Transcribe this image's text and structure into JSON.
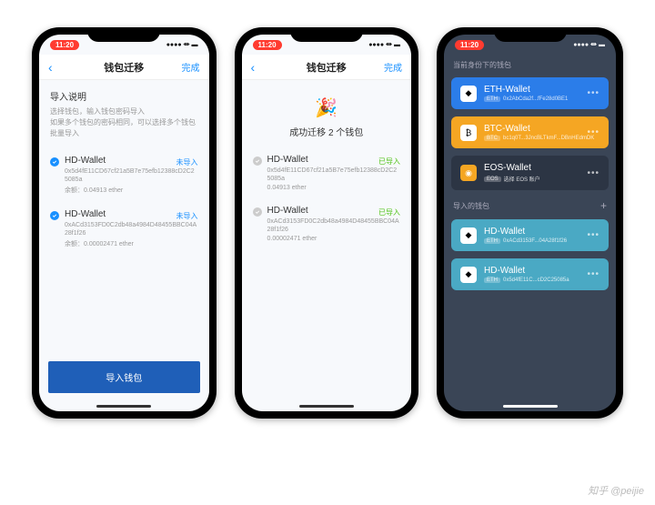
{
  "status_time": "11:20",
  "signal": "●●●● ⏛ ▬",
  "watermark": "知乎 @peijie",
  "s1": {
    "nav_title": "钱包迁移",
    "nav_done": "完成",
    "intro_title": "导入说明",
    "intro_desc1": "选择钱包，输入钱包密码导入",
    "intro_desc2": "如果多个钱包的密码相同，可以选择多个钱包批量导入",
    "w1_name": "HD-Wallet",
    "w1_addr": "0x5d4fE11CD67cf21a5B7e75efb12388cD2C25085a",
    "w1_bal": "余额：0.04913 ether",
    "w1_status": "未导入",
    "w2_name": "HD-Wallet",
    "w2_addr": "0xACd3153FD0C2db48a4984D48455BBC04A28f1f26",
    "w2_bal": "余额：0.00002471 ether",
    "w2_status": "未导入",
    "import_btn": "导入钱包"
  },
  "s2": {
    "nav_title": "钱包迁移",
    "nav_done": "完成",
    "success_text": "成功迁移 2 个钱包",
    "w1_name": "HD-Wallet",
    "w1_addr": "0x5d4fE11CD67cf21a5B7e75efb12388cD2C25085a",
    "w1_bal": "0.04913 ether",
    "w1_status": "已导入",
    "w2_name": "HD-Wallet",
    "w2_addr": "0xACd3153FD0C2db48a4984D48455BBC04A28f1f26",
    "w2_bal": "0.00002471 ether",
    "w2_status": "已导入"
  },
  "s3": {
    "sec1": "当前身份下的钱包",
    "c1_name": "ETH-Wallet",
    "c1_badge": "ETH",
    "c1_addr": "0x2AbCda2f...fFe28d0BE1",
    "c2_name": "BTC-Wallet",
    "c2_badge": "BTC",
    "c2_addr": "bc1q0T...3JncBLTkmF...DBnHEdmDK",
    "c3_name": "EOS-Wallet",
    "c3_badge": "EOS",
    "c3_addr": "选择 EOS 账户",
    "sec2": "导入的钱包",
    "c4_name": "HD-Wallet",
    "c4_badge": "ETH",
    "c4_addr": "0xACd3153F...04A28f1f26",
    "c5_name": "HD-Wallet",
    "c5_badge": "ETH",
    "c5_addr": "0x5d4fE11C...cD2C25085a"
  }
}
